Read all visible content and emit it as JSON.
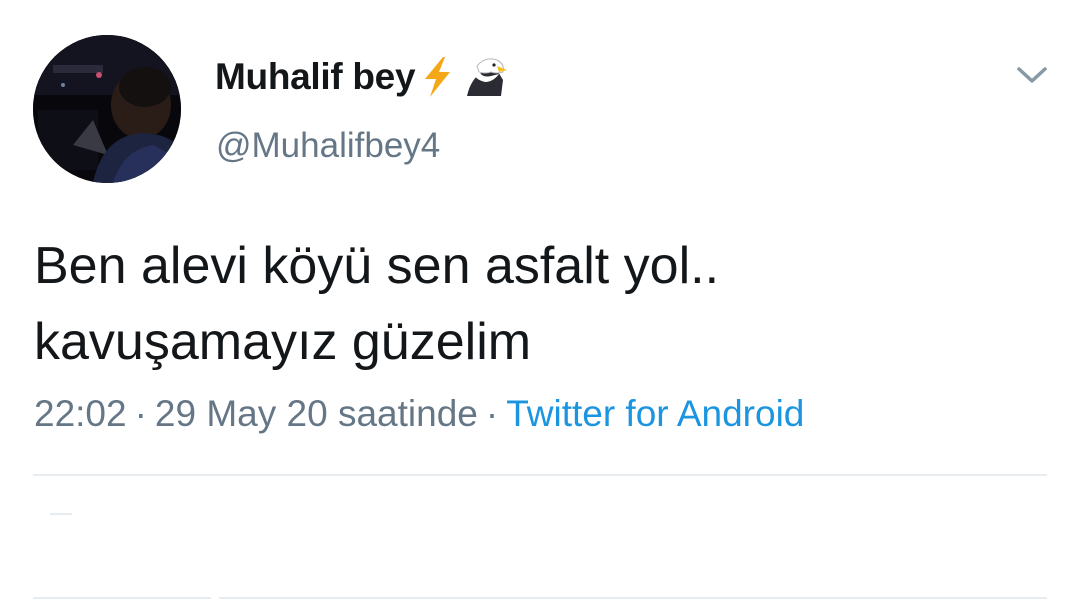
{
  "tweet": {
    "display_name": "Muhalif bey",
    "name_emojis": [
      "lightning-bolt-icon",
      "eagle-icon"
    ],
    "handle": "@Muhalifbey4",
    "text_lines": [
      "Ben alevi köyü sen asfalt yol..",
      "kavuşamayız güzelim"
    ],
    "time": "22:02",
    "date": "29 May 20 saatinde",
    "separator": "·",
    "source": "Twitter for Android",
    "menu_icon": "chevron-down-icon"
  },
  "colors": {
    "text": "#14171a",
    "secondary": "#657786",
    "link": "#1b95e0",
    "divider": "#e6ecf0",
    "bolt": "#f4a818"
  }
}
